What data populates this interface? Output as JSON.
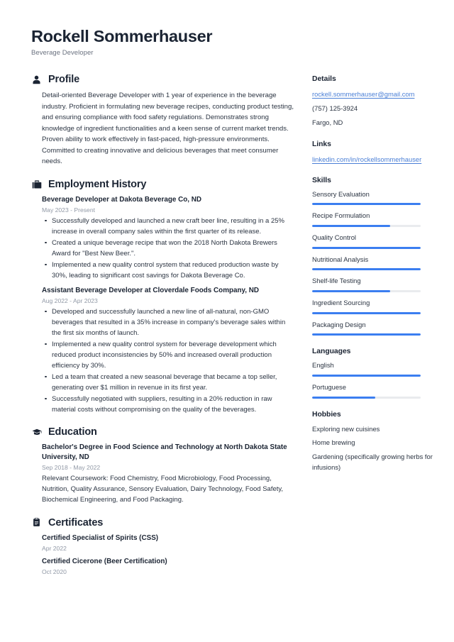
{
  "header": {
    "name": "Rockell Sommerhauser",
    "job_title": "Beverage Developer"
  },
  "theme": {
    "accent": "#3b7ef0",
    "link": "#4a7fd6",
    "text": "#2b3442",
    "heading": "#1b2433",
    "muted": "#9199a6",
    "track": "#e9ebee"
  },
  "main": {
    "profile": {
      "icon": "person-icon",
      "title": "Profile",
      "text": "Detail-oriented Beverage Developer with 1 year of experience in the beverage industry. Proficient in formulating new beverage recipes, conducting product testing, and ensuring compliance with food safety regulations. Demonstrates strong knowledge of ingredient functionalities and a keen sense of current market trends. Proven ability to work effectively in fast-paced, high-pressure environments. Committed to creating innovative and delicious beverages that meet consumer needs."
    },
    "employment": {
      "icon": "briefcase-icon",
      "title": "Employment History",
      "entries": [
        {
          "title": "Beverage Developer at Dakota Beverage Co, ND",
          "date": "May 2023 - Present",
          "bullets": [
            "Successfully developed and launched a new craft beer line, resulting in a 25% increase in overall company sales within the first quarter of its release.",
            "Created a unique beverage recipe that won the 2018 North Dakota Brewers Award for \"Best New Beer.\".",
            "Implemented a new quality control system that reduced production waste by 30%, leading to significant cost savings for Dakota Beverage Co."
          ]
        },
        {
          "title": "Assistant Beverage Developer at Cloverdale Foods Company, ND",
          "date": "Aug 2022 - Apr 2023",
          "bullets": [
            "Developed and successfully launched a new line of all-natural, non-GMO beverages that resulted in a 35% increase in company's beverage sales within the first six months of launch.",
            "Implemented a new quality control system for beverage development which reduced product inconsistencies by 50% and increased overall production efficiency by 30%.",
            "Led a team that created a new seasonal beverage that became a top seller, generating over $1 million in revenue in its first year.",
            "Successfully negotiated with suppliers, resulting in a 20% reduction in raw material costs without compromising on the quality of the beverages."
          ]
        }
      ]
    },
    "education": {
      "icon": "graduation-cap-icon",
      "title": "Education",
      "entries": [
        {
          "title": "Bachelor's Degree in Food Science and Technology at North Dakota State University, ND",
          "date": "Sep 2018 - May 2022",
          "description": "Relevant Coursework: Food Chemistry, Food Microbiology, Food Processing, Nutrition, Quality Assurance, Sensory Evaluation, Dairy Technology, Food Safety, Biochemical Engineering, and Food Packaging."
        }
      ]
    },
    "certificates": {
      "icon": "clipboard-icon",
      "title": "Certificates",
      "entries": [
        {
          "title": "Certified Specialist of Spirits (CSS)",
          "date": "Apr 2022"
        },
        {
          "title": "Certified Cicerone (Beer Certification)",
          "date": "Oct 2020"
        }
      ]
    }
  },
  "sidebar": {
    "details": {
      "title": "Details",
      "email": "rockell.sommerhauser@gmail.com",
      "phone": "(757) 125-3924",
      "location": "Fargo, ND"
    },
    "links": {
      "title": "Links",
      "items": [
        {
          "label": "linkedin.com/in/rockellsommerhauser"
        }
      ]
    },
    "skills": {
      "title": "Skills",
      "items": [
        {
          "label": "Sensory Evaluation",
          "level": 100
        },
        {
          "label": "Recipe Formulation",
          "level": 72
        },
        {
          "label": "Quality Control",
          "level": 100
        },
        {
          "label": "Nutritional Analysis",
          "level": 100
        },
        {
          "label": "Shelf-life Testing",
          "level": 72
        },
        {
          "label": "Ingredient Sourcing",
          "level": 100
        },
        {
          "label": "Packaging Design",
          "level": 100
        }
      ]
    },
    "languages": {
      "title": "Languages",
      "items": [
        {
          "label": "English",
          "level": 100
        },
        {
          "label": "Portuguese",
          "level": 58
        }
      ]
    },
    "hobbies": {
      "title": "Hobbies",
      "items": [
        "Exploring new cuisines",
        "Home brewing",
        "Gardening (specifically growing herbs for infusions)"
      ]
    }
  }
}
